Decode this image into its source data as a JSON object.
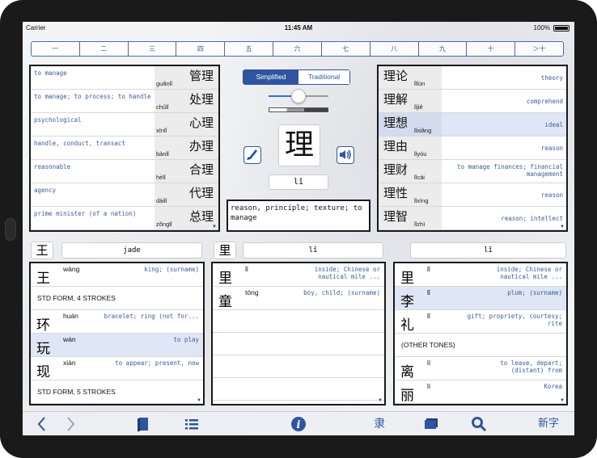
{
  "status": {
    "carrier": "Carrier",
    "time": "11:45 AM",
    "battery": "100%"
  },
  "stroke_segments": [
    "一",
    "二",
    "三",
    "四",
    "五",
    "六",
    "七",
    "八",
    "九",
    "十",
    "＞十"
  ],
  "left_words": [
    {
      "def": "to manage",
      "han": "管理",
      "py": "guǎnlǐ"
    },
    {
      "def": "to manage; to process; to handle",
      "han": "处理",
      "py": "chǔlǐ"
    },
    {
      "def": "psychological",
      "han": "心理",
      "py": "xīnlǐ"
    },
    {
      "def": "handle, conduct, transact",
      "han": "办理",
      "py": "bànlǐ"
    },
    {
      "def": "reasonable",
      "han": "合理",
      "py": "hélǐ"
    },
    {
      "def": "agency",
      "han": "代理",
      "py": "dàilǐ"
    },
    {
      "def": "prime minister (of a nation)",
      "han": "总理",
      "py": "zǒnglǐ"
    }
  ],
  "right_words": [
    {
      "def": "theory",
      "han": "理论",
      "py": "lǐlùn"
    },
    {
      "def": "comprehend",
      "han": "理解",
      "py": "lǐjiě"
    },
    {
      "def": "ideal",
      "han": "理想",
      "py": "lǐxiǎng"
    },
    {
      "def": "reason",
      "han": "理由",
      "py": "lǐyóu"
    },
    {
      "def": "to manage finances; financial management",
      "han": "理财",
      "py": "lǐcái"
    },
    {
      "def": "reason",
      "han": "理性",
      "py": "lǐxìng"
    },
    {
      "def": "reason; intellect",
      "han": "理智",
      "py": "lǐzhì"
    }
  ],
  "script_toggle": {
    "simplified": "Simplified",
    "traditional": "Traditional"
  },
  "center": {
    "character": "理",
    "pinyin": "lǐ",
    "definition": "reason, principle; texture; to manage"
  },
  "component_row": {
    "left_char": "王",
    "left_field": "jade",
    "mid_char": "里",
    "mid_field": "lǐ",
    "right_field": "lǐ"
  },
  "col1": [
    {
      "type": "row",
      "han": "王",
      "py": "wáng",
      "def": "king; (surname)"
    },
    {
      "type": "header",
      "text": "STD FORM, 4 STROKES"
    },
    {
      "type": "row",
      "han": "环",
      "py": "huán",
      "def": "bracelet; ring (not for..."
    },
    {
      "type": "row",
      "han": "玩",
      "py": "wán",
      "def": "to play",
      "sel": true
    },
    {
      "type": "row",
      "han": "现",
      "py": "xiàn",
      "def": "to appear; present, now"
    },
    {
      "type": "header",
      "text": "STD FORM, 5 STROKES"
    }
  ],
  "col2": [
    {
      "type": "row",
      "han": "里",
      "py": "lǐ",
      "def": "inside; Chinese or nautical mile ..."
    },
    {
      "type": "row",
      "han": "童",
      "py": "tóng",
      "def": "boy, child; (surname)"
    }
  ],
  "col3": [
    {
      "type": "row",
      "han": "里",
      "py": "lǐ",
      "def": "inside; Chinese or nautical mile ..."
    },
    {
      "type": "row",
      "han": "李",
      "py": "lǐ",
      "def": "plum; (surname)",
      "sel": true
    },
    {
      "type": "row",
      "han": "礼",
      "py": "lǐ",
      "def": "gift; propriety, courtesy; rite"
    },
    {
      "type": "header",
      "text": "(OTHER TONES)"
    },
    {
      "type": "row",
      "han": "离",
      "py": "lí",
      "def": "to leave, depart; (distant) from"
    },
    {
      "type": "row",
      "han": "丽",
      "py": "lì",
      "def": "Korea"
    }
  ],
  "toolbar": {
    "new_char_label": "新字",
    "strokes_label": "隶"
  },
  "colors": {
    "accent": "#2f55a0",
    "def_text": "#3b5a9a",
    "selected_row": "#dfe6f5"
  }
}
